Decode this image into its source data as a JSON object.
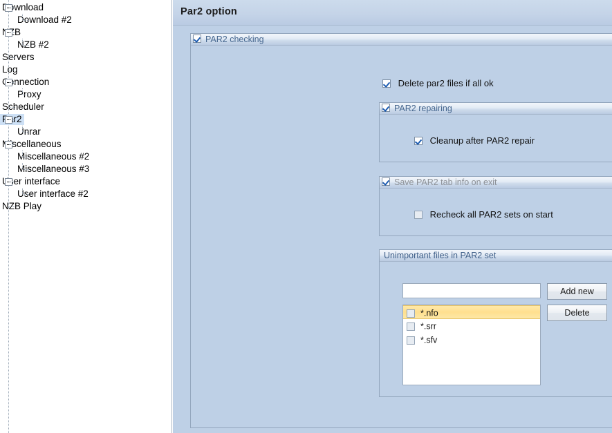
{
  "sidebar": {
    "items": [
      {
        "label": "Download",
        "level": 0,
        "expandable": true,
        "selected": false
      },
      {
        "label": "Download #2",
        "level": 1,
        "expandable": false,
        "selected": false
      },
      {
        "label": "NZB",
        "level": 0,
        "expandable": true,
        "selected": false
      },
      {
        "label": "NZB #2",
        "level": 1,
        "expandable": false,
        "selected": false
      },
      {
        "label": "Servers",
        "level": 0,
        "expandable": false,
        "selected": false
      },
      {
        "label": "Log",
        "level": 0,
        "expandable": false,
        "selected": false
      },
      {
        "label": "Connection",
        "level": 0,
        "expandable": true,
        "selected": false
      },
      {
        "label": "Proxy",
        "level": 1,
        "expandable": false,
        "selected": false
      },
      {
        "label": "Scheduler",
        "level": 0,
        "expandable": false,
        "selected": false
      },
      {
        "label": "Par2",
        "level": 0,
        "expandable": true,
        "selected": true
      },
      {
        "label": "Unrar",
        "level": 1,
        "expandable": false,
        "selected": false
      },
      {
        "label": "Miscellaneous",
        "level": 0,
        "expandable": true,
        "selected": false
      },
      {
        "label": "Miscellaneous #2",
        "level": 1,
        "expandable": false,
        "selected": false
      },
      {
        "label": "Miscellaneous #3",
        "level": 1,
        "expandable": false,
        "selected": false
      },
      {
        "label": "User interface",
        "level": 0,
        "expandable": true,
        "selected": false
      },
      {
        "label": "User interface #2",
        "level": 1,
        "expandable": false,
        "selected": false
      },
      {
        "label": "NZB Play",
        "level": 0,
        "expandable": false,
        "selected": false
      }
    ]
  },
  "header": {
    "title": "Par2 option"
  },
  "groups": {
    "par2_checking": {
      "title": "PAR2 checking",
      "checked": true,
      "option_delete": {
        "label": "Delete par2 files if all ok",
        "checked": true
      }
    },
    "par2_repairing": {
      "title": "PAR2 repairing",
      "checked": true,
      "option_cleanup": {
        "label": "Cleanup after PAR2 repair",
        "checked": true
      }
    },
    "save_tab_info": {
      "title": "Save PAR2 tab info on exit",
      "checked": true,
      "option_recheck": {
        "label": "Recheck all PAR2 sets on start",
        "checked": false
      }
    },
    "unimportant_files": {
      "title": "Unimportant files in PAR2 set",
      "input_value": "",
      "input_placeholder": "",
      "add_button": "Add new",
      "delete_button": "Delete",
      "items": [
        {
          "label": "*.nfo",
          "checked": false,
          "selected": true
        },
        {
          "label": "*.srr",
          "checked": false,
          "selected": false
        },
        {
          "label": "*.sfv",
          "checked": false,
          "selected": false
        }
      ]
    }
  },
  "colors": {
    "panel_bg": "#bed0e6",
    "group_title": "#46678f",
    "group_title_disabled": "#8c9096",
    "selection_tree": "#cde0f5",
    "list_highlight": "#ffe08f",
    "checkmark": "#1a5ab0"
  }
}
